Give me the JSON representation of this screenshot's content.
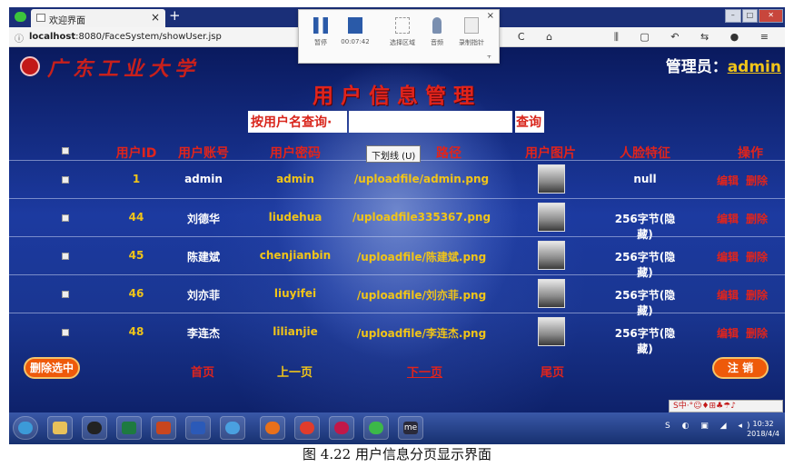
{
  "browser": {
    "tab_title": "欢迎界面",
    "tab_close": "×",
    "new_tab": "+",
    "url_host": "localhost",
    "url_rest": ":8080/FaceSystem/showUser.jsp",
    "nav_glyphs": "› C ⌂",
    "tool_glyphs": "⫼ ▢ ↶ ⇆ ● ≡"
  },
  "recorder": {
    "pause_label": "暂停",
    "time": "00:07:42",
    "region_label": "选择区域",
    "mic_label": "音频",
    "pointer_label": "录制指针",
    "close": "×",
    "pin": "⫟"
  },
  "page": {
    "logo_text": "广东工业大学",
    "admin_label": "管理员：",
    "admin_name": "admin",
    "title": "用户信息管理",
    "search_select": "按用户名查询·",
    "search_value": "",
    "search_button": "查询",
    "tooltip": "下划线 (U)"
  },
  "table": {
    "headers": [
      "用户ID",
      "用户账号",
      "用户密码",
      "路径",
      "用户图片",
      "人脸特征",
      "操作"
    ],
    "rows": [
      {
        "id": "1",
        "account": "admin",
        "password": "admin",
        "path": "/uploadfile/admin.png",
        "feature": "null"
      },
      {
        "id": "44",
        "account": "刘德华",
        "password": "liudehua",
        "path": "/uploadfile335367.png",
        "feature": "256字节(隐藏)"
      },
      {
        "id": "45",
        "account": "陈建斌",
        "password": "chenjianbin",
        "path": "/uploadfile/陈建斌.png",
        "feature": "256字节(隐藏)"
      },
      {
        "id": "46",
        "account": "刘亦菲",
        "password": "liuyifei",
        "path": "/uploadfile/刘亦菲.png",
        "feature": "256字节(隐藏)"
      },
      {
        "id": "48",
        "account": "李连杰",
        "password": "lilianjie",
        "path": "/uploadfile/李连杰.png",
        "feature": "256字节(隐藏)"
      }
    ],
    "edit_label": "编辑",
    "delete_label": "删除"
  },
  "footer": {
    "delete_selected": "删除选中",
    "first": "首页",
    "prev": "上一页",
    "next": "下一页",
    "last": "尾页",
    "logout": "注 销"
  },
  "taskbar": {
    "ime_text": "S中·°☺♦⊞♣☂♪",
    "tray": "S ◐ ▣ ◢ ◂)",
    "time": "10:32",
    "date": "2018/4/4",
    "me_label": "me"
  },
  "caption": "图 4.22 用户信息分页显示界面"
}
